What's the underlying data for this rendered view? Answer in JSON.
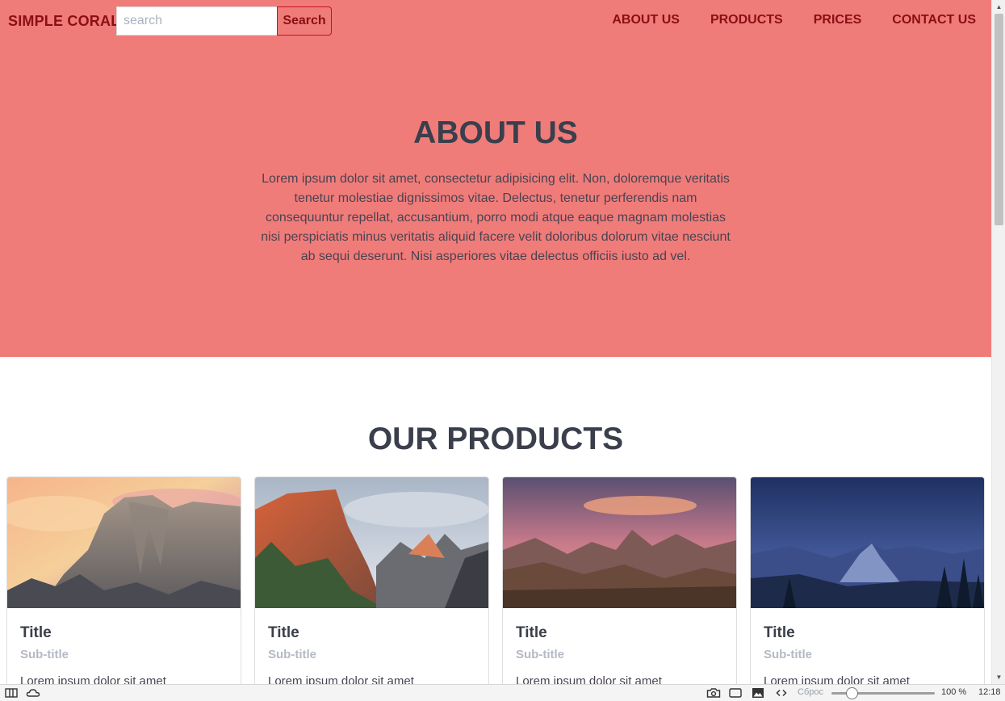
{
  "navbar": {
    "brand": "SIMPLE CORAL",
    "search_placeholder": "search",
    "search_button": "Search",
    "links": [
      "ABOUT US",
      "PRODUCTS",
      "PRICES",
      "CONTACT US"
    ]
  },
  "about": {
    "title": "ABOUT US",
    "text": "Lorem ipsum dolor sit amet, consectetur adipisicing elit. Non, doloremque veritatis tenetur molestiae dignissimos vitae. Delectus, tenetur perferendis nam consequuntur repellat, accusantium, porro modi atque eaque magnam molestias nisi perspiciatis minus veritatis aliquid facere velit doloribus dolorum vitae nesciunt ab sequi deserunt. Nisi asperiores vitae delectus officiis iusto ad vel."
  },
  "products": {
    "title": "OUR PRODUCTS",
    "cards": [
      {
        "title": "Title",
        "subtitle": "Sub-title",
        "text": "Lorem ipsum dolor sit amet",
        "image": "half-dome-sunset-image"
      },
      {
        "title": "Title",
        "subtitle": "Sub-title",
        "text": "Lorem ipsum dolor sit amet",
        "image": "el-capitan-image"
      },
      {
        "title": "Title",
        "subtitle": "Sub-title",
        "text": "Lorem ipsum dolor sit amet",
        "image": "sierra-dusk-image"
      },
      {
        "title": "Title",
        "subtitle": "Sub-title",
        "text": "Lorem ipsum dolor sit amet",
        "image": "yosemite-night-image"
      }
    ]
  },
  "colors": {
    "hero_background": "#f07c7a",
    "nav_text": "#8a0f12",
    "heading_text": "#3a3f4b",
    "subtitle_text": "#b4b9c4"
  },
  "statusbar": {
    "reset_label": "Сброс",
    "zoom_level": "100 %",
    "clock": "12:18",
    "zoom_fraction": 0.2,
    "icons": [
      "panel-icon",
      "cloud-icon",
      "camera-icon",
      "window-icon",
      "image-icon",
      "code-icon"
    ]
  }
}
